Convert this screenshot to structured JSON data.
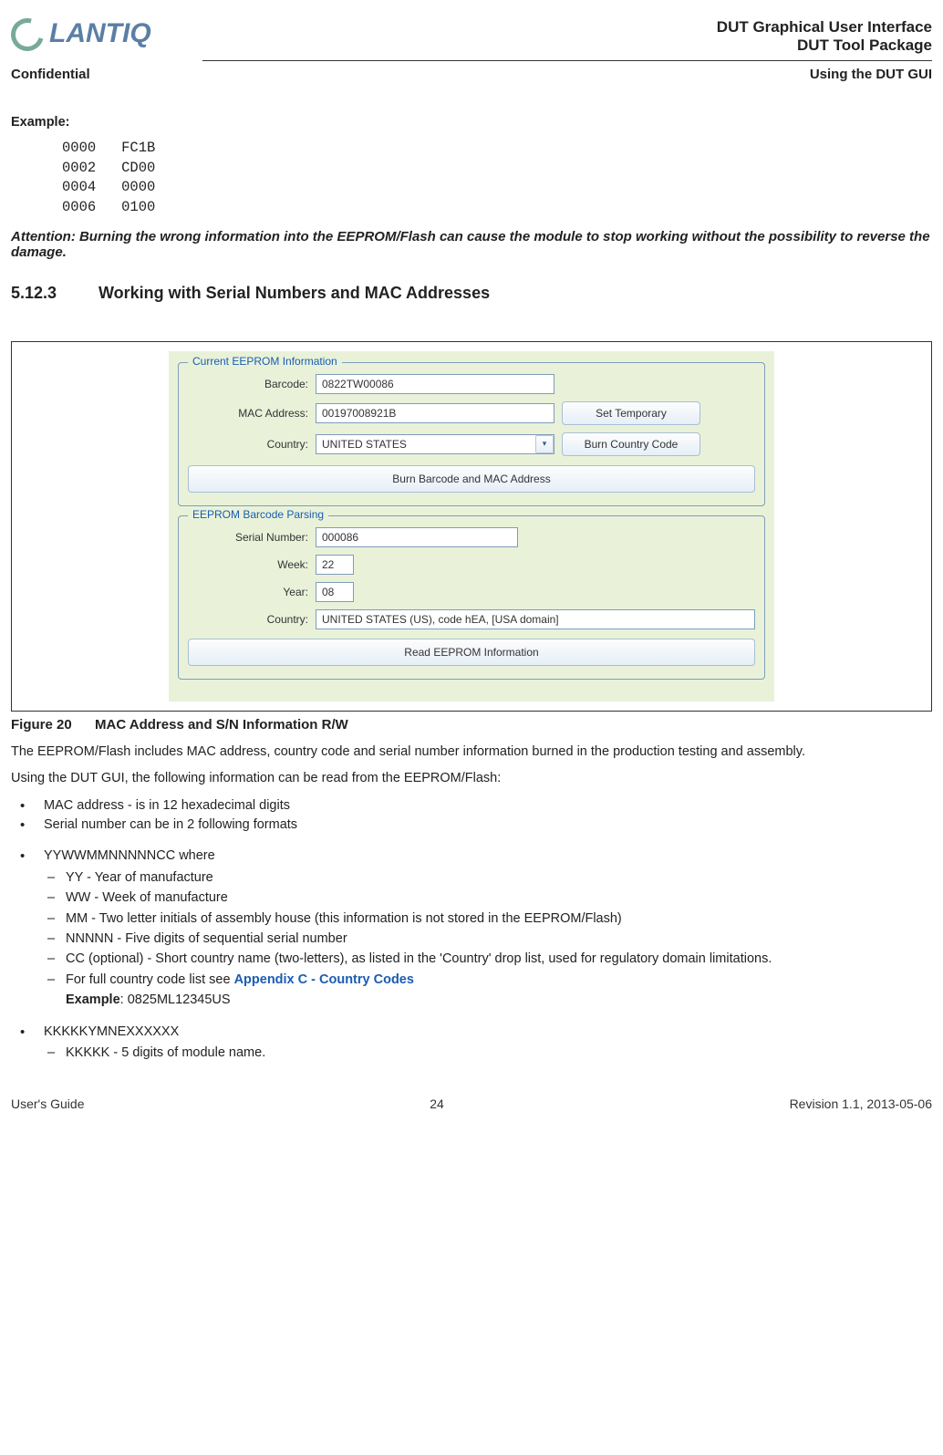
{
  "header": {
    "logo_text": "LANTIQ",
    "title1": "DUT Graphical User Interface",
    "title2": "DUT Tool Package",
    "confidential": "Confidential",
    "using": "Using the DUT GUI"
  },
  "example": {
    "label": "Example:",
    "code": "0000   FC1B\n0002   CD00\n0004   0000\n0006   0100"
  },
  "attention": "Attention: Burning the wrong information into the EEPROM/Flash can cause the module to stop working without the possibility to reverse the damage.",
  "section": {
    "number": "5.12.3",
    "title": "Working with Serial Numbers and MAC Addresses"
  },
  "gui": {
    "group1": {
      "legend": "Current EEPROM Information",
      "barcode_label": "Barcode:",
      "barcode_value": "0822TW00086",
      "mac_label": "MAC Address:",
      "mac_value": "00197008921B",
      "set_temp": "Set Temporary",
      "country_label": "Country:",
      "country_value": "UNITED STATES",
      "burn_country": "Burn Country Code",
      "burn_barcode_mac": "Burn Barcode and MAC Address"
    },
    "group2": {
      "legend": "EEPROM Barcode Parsing",
      "serial_label": "Serial Number:",
      "serial_value": "000086",
      "week_label": "Week:",
      "week_value": "22",
      "year_label": "Year:",
      "year_value": "08",
      "country_label": "Country:",
      "country_value": "UNITED STATES (US), code hEA, [USA domain]",
      "read_btn": "Read EEPROM Information"
    }
  },
  "figure": {
    "number": "Figure 20",
    "caption": "MAC Address and S/N Information R/W"
  },
  "body": {
    "p1": "The EEPROM/Flash includes MAC address, country code and serial number information burned in the production testing and assembly.",
    "p2": "Using the DUT GUI, the following information can be read from the EEPROM/Flash:",
    "b1": "MAC address - is in 12 hexadecimal digits",
    "b2": "Serial number can be in 2 following formats",
    "b3": "YYWWMMNNNNNCC where",
    "s1": "YY - Year of manufacture",
    "s2": "WW - Week of manufacture",
    "s3": "MM - Two letter initials of assembly house (this information is not stored in the EEPROM/Flash)",
    "s4": "NNNNN - Five digits of sequential serial number",
    "s5": "CC (optional) - Short country name (two-letters), as listed in the 'Country' drop list, used for regulatory domain limitations.",
    "s6a": "For full country code list see ",
    "s6link": "Appendix C - Country Codes",
    "s6ex_label": "Example",
    "s6ex_val": ": 0825ML12345US",
    "b4": "KKKKKYMNEXXXXXX",
    "s7": "KKKKK - 5 digits of module name."
  },
  "footer": {
    "left": "User's Guide",
    "center": "24",
    "right": "Revision 1.1, 2013-05-06"
  }
}
